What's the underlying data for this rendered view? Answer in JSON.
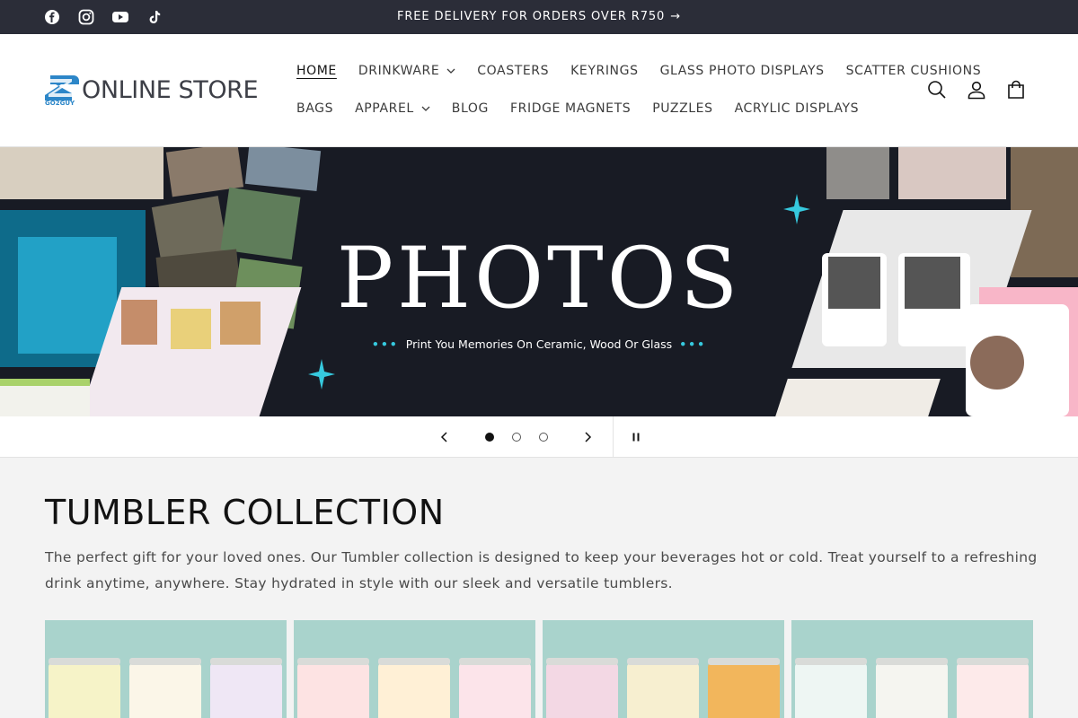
{
  "announcement": {
    "text": "FREE DELIVERY FOR ORDERS OVER R750",
    "arrow": "→",
    "social_icons": [
      "facebook-icon",
      "instagram-icon",
      "youtube-icon",
      "tiktok-icon"
    ]
  },
  "header": {
    "logo_text": "ONLINE STORE",
    "logo_sub": "GO2GUY",
    "nav_row1": [
      {
        "label": "HOME",
        "active": true
      },
      {
        "label": "DRINKWARE",
        "dropdown": true
      },
      {
        "label": "COASTERS"
      },
      {
        "label": "KEYRINGS"
      },
      {
        "label": "GLASS PHOTO DISPLAYS"
      },
      {
        "label": "SCATTER CUSHIONS"
      }
    ],
    "nav_row2": [
      {
        "label": "BAGS"
      },
      {
        "label": "APPAREL",
        "dropdown": true
      },
      {
        "label": "BLOG"
      },
      {
        "label": "FRIDGE MAGNETS"
      },
      {
        "label": "PUZZLES"
      },
      {
        "label": "ACRYLIC DISPLAYS"
      }
    ],
    "icons": [
      "search-icon",
      "account-icon",
      "cart-icon"
    ]
  },
  "banner": {
    "title": "PHOTOS",
    "subtitle": "Print You Memories On Ceramic, Wood Or Glass",
    "dots": "•••"
  },
  "slider": {
    "slide_count": 3,
    "current_slide": 1,
    "icons": [
      "chevron-left-icon",
      "chevron-right-icon",
      "pause-icon"
    ]
  },
  "collection": {
    "title": "TUMBLER COLLECTION",
    "description": "The perfect gift for your loved ones. Our Tumbler collection is designed to keep your beverages hot or cold. Treat yourself to a refreshing drink anytime, anywhere. Stay hydrated in style with our sleek and versatile tumblers."
  },
  "colors": {
    "announcement_bg": "#2b2d38",
    "banner_bg": "#181b24",
    "accent": "#36c9de",
    "logo_blue": "#2c86c8",
    "card_bg": "#a9d3cc"
  }
}
